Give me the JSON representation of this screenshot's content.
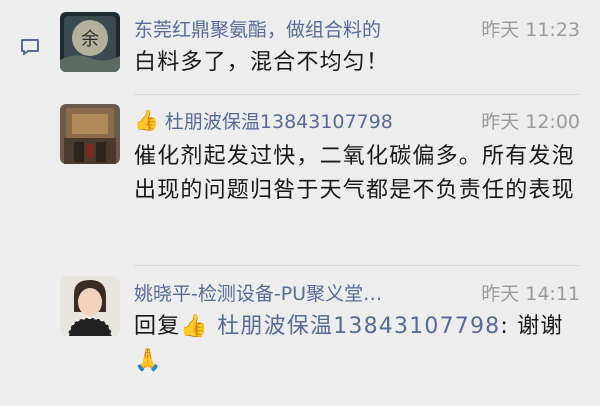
{
  "comments": [
    {
      "name": "东莞红鼎聚氨酯，做组合料的",
      "time": "昨天 11:23",
      "avatar_char": "余",
      "text": "白料多了，混合不均匀！"
    },
    {
      "name_emoji": "👍",
      "name": "杜朋波保温13843107798",
      "time": "昨天 12:00",
      "text": "催化剂起发过快，二氧化碳偏多。所有发泡出现的问题归咎于天气都是不负责任的表现"
    },
    {
      "name": "姚晓平-检测设备-PU聚义堂…",
      "time": "昨天 14:11",
      "reply_prefix": "回复",
      "reply_emoji": "👍",
      "reply_to": "杜朋波保温13843107798",
      "reply_colon": ":",
      "text": "谢谢",
      "end_emoji": "🙏"
    }
  ],
  "colors": {
    "background": "#ededed",
    "name": "#576b95",
    "time": "#9b9b9b",
    "text": "#191919"
  }
}
